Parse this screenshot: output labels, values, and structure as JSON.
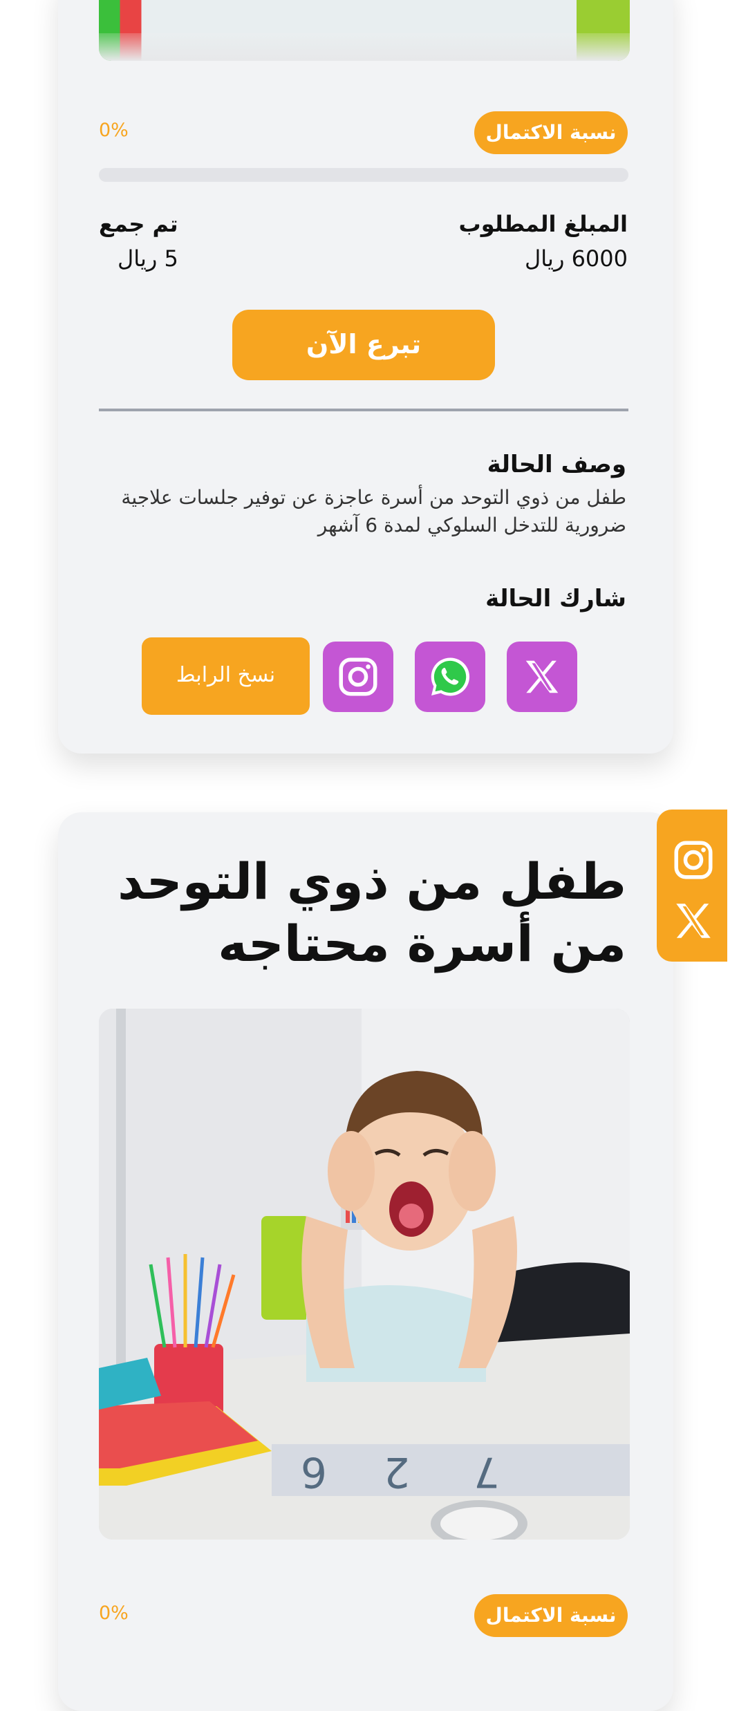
{
  "case_card": {
    "completion": {
      "badge_label": "نسبة الاكتمال",
      "percent_text": "0%",
      "progress_fraction": 0
    },
    "required_amount": {
      "label": "المبلغ المطلوب",
      "value": "6000 ريال"
    },
    "collected_amount": {
      "label": "تم جمع",
      "value": "5 ريال"
    },
    "donate_button": "تبرع الآن",
    "description": {
      "title": "وصف الحالة",
      "text": "طفل من ذوي التوحد من أسرة عاجزة عن توفير جلسات علاجية ضرورية للتدخل السلوكي لمدة 6 آشهر"
    },
    "share": {
      "title": "شارك الحالة",
      "copy_link_button": "نسخ الرابط",
      "icons": [
        "x-icon",
        "whatsapp-icon",
        "instagram-icon"
      ]
    }
  },
  "side_share_tab": {
    "icons": [
      "instagram-icon",
      "x-icon"
    ]
  },
  "next_case_card": {
    "title_line1": "طفل من ذوي التوحد",
    "title_line2": "من أسرة محتاجه",
    "completion": {
      "badge_label": "نسبة الاكتمال",
      "percent_text": "0%"
    }
  },
  "colors": {
    "accent_orange": "#f7a520",
    "share_purple": "#c456d4",
    "card_background": "#f2f3f5"
  }
}
